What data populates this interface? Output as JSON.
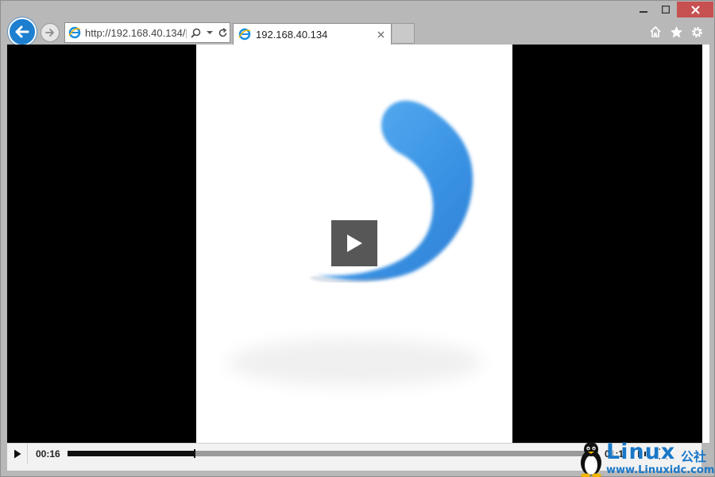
{
  "browser": {
    "address_url": "http://192.168.40.134/|",
    "tab_title": "192.168.40.134"
  },
  "video": {
    "current_time": "00:16",
    "total_time": "01:1",
    "progress": 0.24
  },
  "watermark": {
    "brand": "Linux",
    "brand_cn": "公社",
    "url": "www.Linuxidc.com"
  },
  "colors": {
    "accent_blue": "#1e7fd0",
    "close_red": "#c75050",
    "video_bg": "#000000",
    "brand_blue": "#1a78c8"
  },
  "icons": {
    "back": "back-arrow-icon",
    "forward": "forward-arrow-icon",
    "search": "search-icon",
    "dropdown": "chevron-down-icon",
    "refresh": "refresh-icon",
    "home": "home-icon",
    "favorites": "star-icon",
    "settings": "gear-icon",
    "play": "play-icon",
    "fullscreen": "fullscreen-icon"
  }
}
